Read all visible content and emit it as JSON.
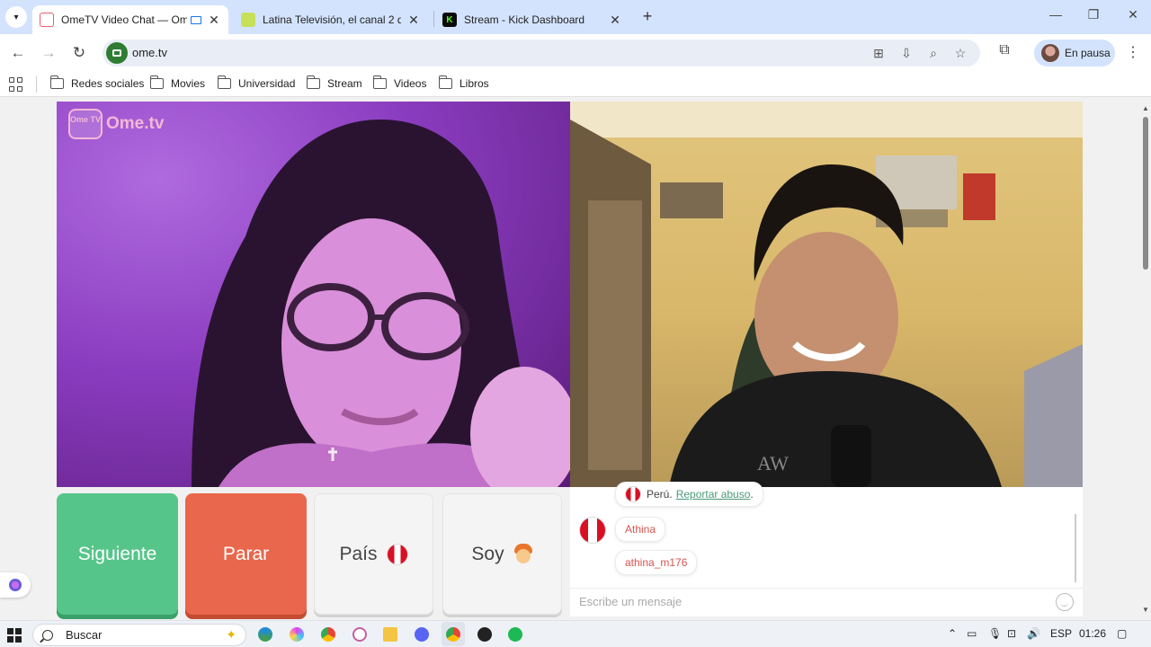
{
  "browser": {
    "tabs": [
      {
        "title": "OmeTV Video Chat — Ome",
        "favicon_color": "#f05a6b",
        "active": true
      },
      {
        "title": "Latina Televisión, el canal 2 de",
        "favicon_color": "#8bc34a",
        "active": false
      },
      {
        "title": "Stream - Kick Dashboard",
        "favicon_color": "#53fc18",
        "active": false
      }
    ],
    "url": "ome.tv",
    "profile_label": "En pausa"
  },
  "bookmarks": [
    {
      "label": "Redes sociales"
    },
    {
      "label": "Movies"
    },
    {
      "label": "Universidad"
    },
    {
      "label": "Stream"
    },
    {
      "label": "Videos"
    },
    {
      "label": "Libros"
    }
  ],
  "page": {
    "logo_small": "Ome TV",
    "logo_text": "Ome.tv",
    "buttons": {
      "next": "Siguiente",
      "stop": "Parar",
      "country": "País",
      "gender": "Soy"
    },
    "chat": {
      "country_text": "Perú.",
      "report_link": "Reportar abuso",
      "report_suffix": ".",
      "messages": [
        "Athina",
        "athina_m176"
      ],
      "input_placeholder": "Escribe un mensaje"
    }
  },
  "taskbar": {
    "search_label": "Buscar",
    "language": "ESP",
    "time": "01:26"
  },
  "colors": {
    "next_button": "#56c58a",
    "stop_button": "#e9674c",
    "tab_strip": "#d3e3fd"
  }
}
